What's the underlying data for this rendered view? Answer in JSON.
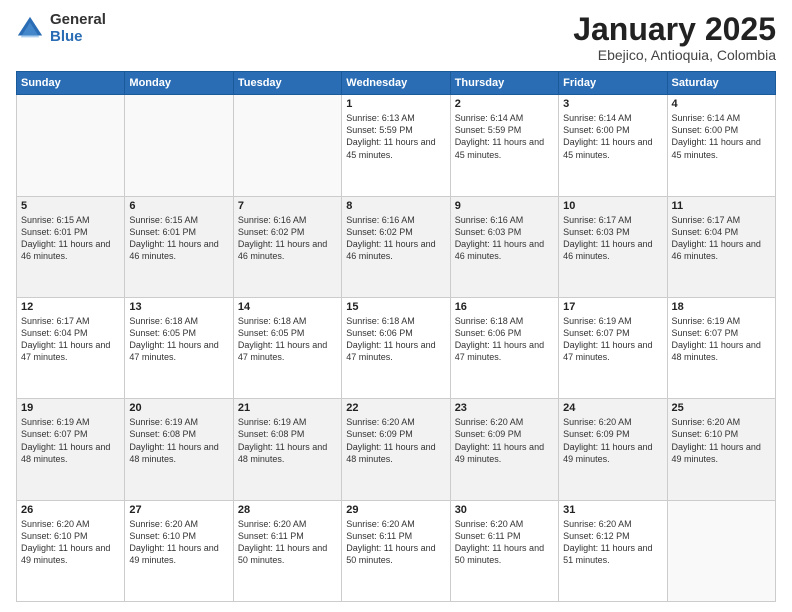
{
  "logo": {
    "general": "General",
    "blue": "Blue"
  },
  "header": {
    "month": "January 2025",
    "location": "Ebejico, Antioquia, Colombia"
  },
  "weekdays": [
    "Sunday",
    "Monday",
    "Tuesday",
    "Wednesday",
    "Thursday",
    "Friday",
    "Saturday"
  ],
  "weeks": [
    [
      {
        "day": "",
        "sunrise": "",
        "sunset": "",
        "daylight": ""
      },
      {
        "day": "",
        "sunrise": "",
        "sunset": "",
        "daylight": ""
      },
      {
        "day": "",
        "sunrise": "",
        "sunset": "",
        "daylight": ""
      },
      {
        "day": "1",
        "sunrise": "Sunrise: 6:13 AM",
        "sunset": "Sunset: 5:59 PM",
        "daylight": "Daylight: 11 hours and 45 minutes."
      },
      {
        "day": "2",
        "sunrise": "Sunrise: 6:14 AM",
        "sunset": "Sunset: 5:59 PM",
        "daylight": "Daylight: 11 hours and 45 minutes."
      },
      {
        "day": "3",
        "sunrise": "Sunrise: 6:14 AM",
        "sunset": "Sunset: 6:00 PM",
        "daylight": "Daylight: 11 hours and 45 minutes."
      },
      {
        "day": "4",
        "sunrise": "Sunrise: 6:14 AM",
        "sunset": "Sunset: 6:00 PM",
        "daylight": "Daylight: 11 hours and 45 minutes."
      }
    ],
    [
      {
        "day": "5",
        "sunrise": "Sunrise: 6:15 AM",
        "sunset": "Sunset: 6:01 PM",
        "daylight": "Daylight: 11 hours and 46 minutes."
      },
      {
        "day": "6",
        "sunrise": "Sunrise: 6:15 AM",
        "sunset": "Sunset: 6:01 PM",
        "daylight": "Daylight: 11 hours and 46 minutes."
      },
      {
        "day": "7",
        "sunrise": "Sunrise: 6:16 AM",
        "sunset": "Sunset: 6:02 PM",
        "daylight": "Daylight: 11 hours and 46 minutes."
      },
      {
        "day": "8",
        "sunrise": "Sunrise: 6:16 AM",
        "sunset": "Sunset: 6:02 PM",
        "daylight": "Daylight: 11 hours and 46 minutes."
      },
      {
        "day": "9",
        "sunrise": "Sunrise: 6:16 AM",
        "sunset": "Sunset: 6:03 PM",
        "daylight": "Daylight: 11 hours and 46 minutes."
      },
      {
        "day": "10",
        "sunrise": "Sunrise: 6:17 AM",
        "sunset": "Sunset: 6:03 PM",
        "daylight": "Daylight: 11 hours and 46 minutes."
      },
      {
        "day": "11",
        "sunrise": "Sunrise: 6:17 AM",
        "sunset": "Sunset: 6:04 PM",
        "daylight": "Daylight: 11 hours and 46 minutes."
      }
    ],
    [
      {
        "day": "12",
        "sunrise": "Sunrise: 6:17 AM",
        "sunset": "Sunset: 6:04 PM",
        "daylight": "Daylight: 11 hours and 47 minutes."
      },
      {
        "day": "13",
        "sunrise": "Sunrise: 6:18 AM",
        "sunset": "Sunset: 6:05 PM",
        "daylight": "Daylight: 11 hours and 47 minutes."
      },
      {
        "day": "14",
        "sunrise": "Sunrise: 6:18 AM",
        "sunset": "Sunset: 6:05 PM",
        "daylight": "Daylight: 11 hours and 47 minutes."
      },
      {
        "day": "15",
        "sunrise": "Sunrise: 6:18 AM",
        "sunset": "Sunset: 6:06 PM",
        "daylight": "Daylight: 11 hours and 47 minutes."
      },
      {
        "day": "16",
        "sunrise": "Sunrise: 6:18 AM",
        "sunset": "Sunset: 6:06 PM",
        "daylight": "Daylight: 11 hours and 47 minutes."
      },
      {
        "day": "17",
        "sunrise": "Sunrise: 6:19 AM",
        "sunset": "Sunset: 6:07 PM",
        "daylight": "Daylight: 11 hours and 47 minutes."
      },
      {
        "day": "18",
        "sunrise": "Sunrise: 6:19 AM",
        "sunset": "Sunset: 6:07 PM",
        "daylight": "Daylight: 11 hours and 48 minutes."
      }
    ],
    [
      {
        "day": "19",
        "sunrise": "Sunrise: 6:19 AM",
        "sunset": "Sunset: 6:07 PM",
        "daylight": "Daylight: 11 hours and 48 minutes."
      },
      {
        "day": "20",
        "sunrise": "Sunrise: 6:19 AM",
        "sunset": "Sunset: 6:08 PM",
        "daylight": "Daylight: 11 hours and 48 minutes."
      },
      {
        "day": "21",
        "sunrise": "Sunrise: 6:19 AM",
        "sunset": "Sunset: 6:08 PM",
        "daylight": "Daylight: 11 hours and 48 minutes."
      },
      {
        "day": "22",
        "sunrise": "Sunrise: 6:20 AM",
        "sunset": "Sunset: 6:09 PM",
        "daylight": "Daylight: 11 hours and 48 minutes."
      },
      {
        "day": "23",
        "sunrise": "Sunrise: 6:20 AM",
        "sunset": "Sunset: 6:09 PM",
        "daylight": "Daylight: 11 hours and 49 minutes."
      },
      {
        "day": "24",
        "sunrise": "Sunrise: 6:20 AM",
        "sunset": "Sunset: 6:09 PM",
        "daylight": "Daylight: 11 hours and 49 minutes."
      },
      {
        "day": "25",
        "sunrise": "Sunrise: 6:20 AM",
        "sunset": "Sunset: 6:10 PM",
        "daylight": "Daylight: 11 hours and 49 minutes."
      }
    ],
    [
      {
        "day": "26",
        "sunrise": "Sunrise: 6:20 AM",
        "sunset": "Sunset: 6:10 PM",
        "daylight": "Daylight: 11 hours and 49 minutes."
      },
      {
        "day": "27",
        "sunrise": "Sunrise: 6:20 AM",
        "sunset": "Sunset: 6:10 PM",
        "daylight": "Daylight: 11 hours and 49 minutes."
      },
      {
        "day": "28",
        "sunrise": "Sunrise: 6:20 AM",
        "sunset": "Sunset: 6:11 PM",
        "daylight": "Daylight: 11 hours and 50 minutes."
      },
      {
        "day": "29",
        "sunrise": "Sunrise: 6:20 AM",
        "sunset": "Sunset: 6:11 PM",
        "daylight": "Daylight: 11 hours and 50 minutes."
      },
      {
        "day": "30",
        "sunrise": "Sunrise: 6:20 AM",
        "sunset": "Sunset: 6:11 PM",
        "daylight": "Daylight: 11 hours and 50 minutes."
      },
      {
        "day": "31",
        "sunrise": "Sunrise: 6:20 AM",
        "sunset": "Sunset: 6:12 PM",
        "daylight": "Daylight: 11 hours and 51 minutes."
      },
      {
        "day": "",
        "sunrise": "",
        "sunset": "",
        "daylight": ""
      }
    ]
  ],
  "rowShading": [
    false,
    true,
    false,
    true,
    false
  ]
}
